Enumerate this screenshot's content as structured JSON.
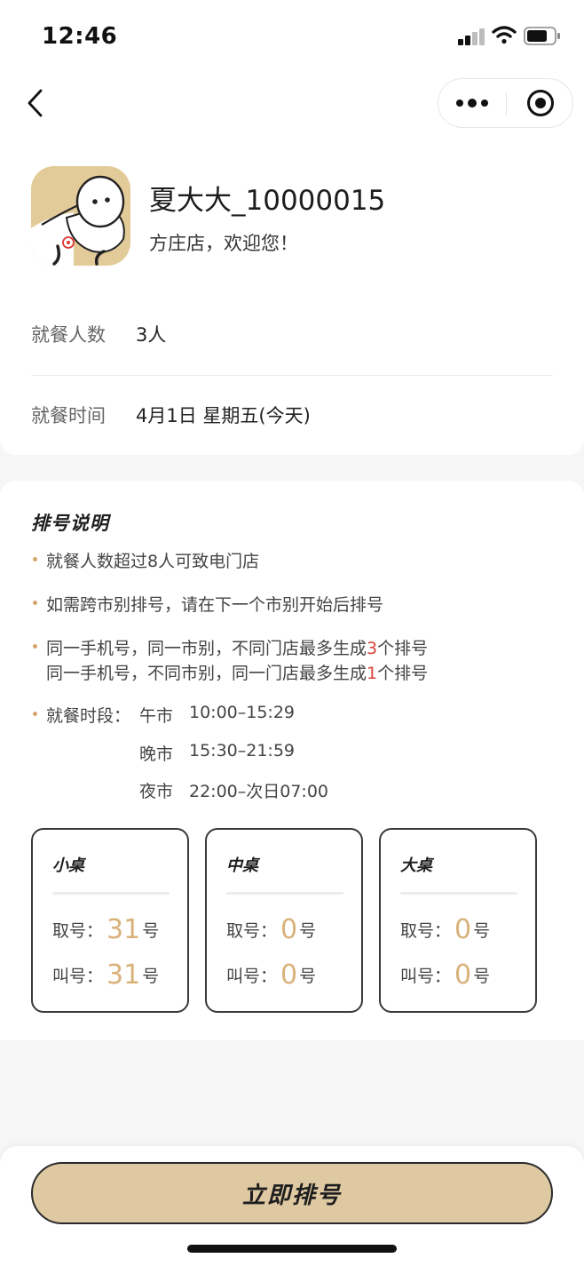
{
  "status_bar": {
    "time": "12:46"
  },
  "nav": {
    "back_icon": "chevron-left-icon",
    "more_icon": "more-dots-icon",
    "close_icon": "target-circle-icon"
  },
  "user": {
    "name": "夏大大_10000015",
    "welcome": "方庄店，欢迎您！",
    "avatar_bg": "#e3cb99"
  },
  "info": {
    "diners_label": "就餐人数",
    "diners_value": "3人",
    "time_label": "就餐时间",
    "time_value": "4月1日 星期五(今天)"
  },
  "rules": {
    "title": "排号说明",
    "rule1": "就餐人数超过8人可致电门店",
    "rule2": "如需跨市别排号，请在下一个市别开始后排号",
    "rule3a_pre": "同一手机号，同一市别，不同门店最多生成",
    "rule3a_num": "3",
    "rule3a_post": "个排号",
    "rule3b_pre": "同一手机号，不同市别，同一门店最多生成",
    "rule3b_num": "1",
    "rule3b_post": "个排号",
    "periods_label": "就餐时段：",
    "periods": [
      {
        "name": "午市",
        "time": "10:00–15:29"
      },
      {
        "name": "晚市",
        "time": "15:30–21:59"
      },
      {
        "name": "夜市",
        "time": "22:00–次日07:00"
      }
    ]
  },
  "tables": [
    {
      "title": "小桌",
      "take_label": "取号：",
      "take_num": "31",
      "call_label": "叫号：",
      "call_num": "31",
      "unit": "号"
    },
    {
      "title": "中桌",
      "take_label": "取号：",
      "take_num": "0",
      "call_label": "叫号：",
      "call_num": "0",
      "unit": "号"
    },
    {
      "title": "大桌",
      "take_label": "取号：",
      "take_num": "0",
      "call_label": "叫号：",
      "call_num": "0",
      "unit": "号"
    }
  ],
  "action": {
    "button_label": "立即排号"
  },
  "colors": {
    "accent_gold": "#d9b27a",
    "button_bg": "#dfc9a3",
    "highlight_red": "#d9433a",
    "bullet": "#d4a66f"
  }
}
